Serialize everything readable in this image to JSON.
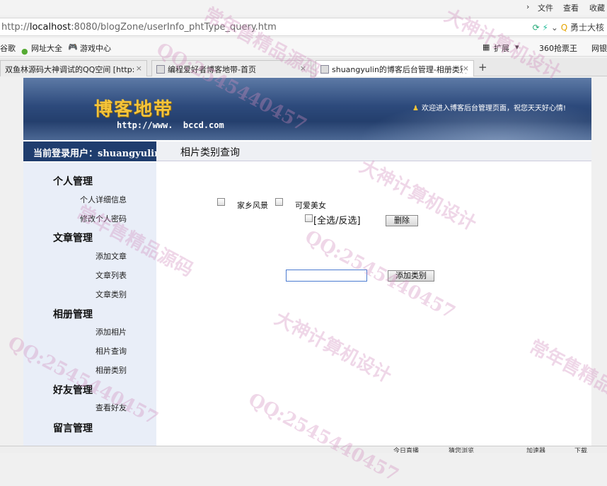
{
  "browser": {
    "menu": [
      "文件",
      "查看",
      "收藏"
    ],
    "url_prefix": "http://",
    "url_host": "localhost",
    "url_rest": ":8080/blogZone/userInfo_phtType_query.htm",
    "search_text": "勇士大核",
    "favorites": [
      "谷歌",
      "网址大全",
      "游戏中心",
      "扩展",
      "360抢票王",
      "网银"
    ],
    "tabs": [
      {
        "title": "双鱼林源码大神调试的QQ空间 [http:"
      },
      {
        "title": "编程爱好者博客地带-首页"
      },
      {
        "title": "shuangyulin的博客后台管理-相册类别"
      }
    ],
    "new_tab": "+"
  },
  "header": {
    "logo": "博客地带",
    "logo_url": "http://www.  bccd.com",
    "welcome": "欢迎进入博客后台管理页面，祝您天天好心情!"
  },
  "userbar": {
    "current_user": "当前登录用户：shuangyulin",
    "page_title": "相片类别查询"
  },
  "sidebar": {
    "groups": [
      {
        "title": "个人管理",
        "items": [
          "个人详细信息",
          "修改个人密码"
        ]
      },
      {
        "title": "文章管理",
        "items": [
          "添加文章",
          "文章列表",
          "文章类别"
        ]
      },
      {
        "title": "相册管理",
        "items": [
          "添加相片",
          "相片查询",
          "相册类别"
        ]
      },
      {
        "title": "好友管理",
        "items": [
          "查看好友"
        ]
      },
      {
        "title": "留言管理",
        "items": []
      }
    ]
  },
  "content": {
    "categories": [
      "家乡风景",
      "可爱美女"
    ],
    "select_all_label": "[全选/反选]",
    "delete_button": "删除",
    "new_category_value": "",
    "add_button": "添加类别"
  },
  "status": [
    "今日直播",
    "猜您浏览",
    "加速器",
    "下载"
  ],
  "watermark": [
    "大神计算机设计",
    "QQ:2545440457",
    "常年售精品源码"
  ]
}
